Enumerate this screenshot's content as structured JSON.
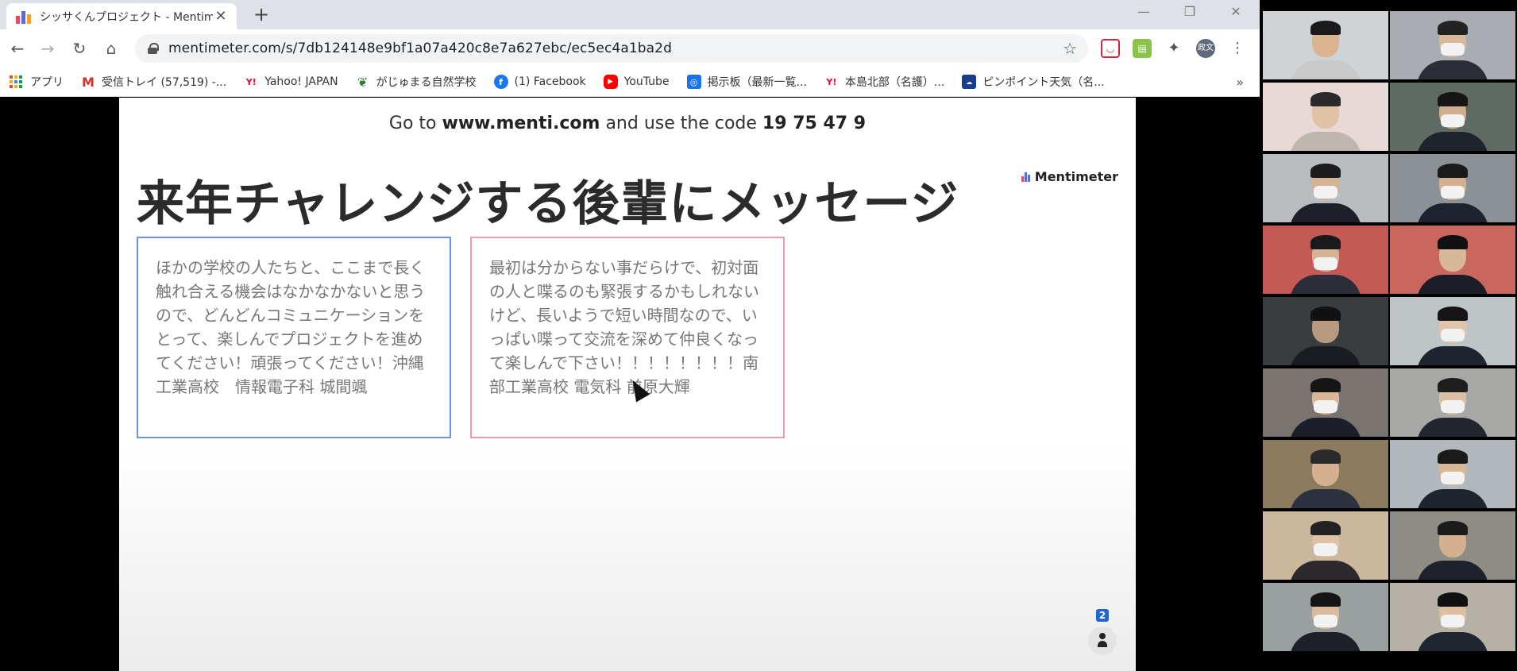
{
  "browser": {
    "tab": {
      "title": "シッサくんプロジェクト - Mentimeter"
    },
    "url": "mentimeter.com/s/7db124148e9bf1a07a420c8e7a627ebc/ec5ec4a1ba2d",
    "profile_label": "政文",
    "window_controls": {
      "minimize": "—",
      "restore": "❐",
      "close": "✕"
    },
    "bookmarks": [
      {
        "label": "アプリ",
        "icon": "apps-icon"
      },
      {
        "label": "受信トレイ (57,519) -...",
        "icon": "gmail-icon"
      },
      {
        "label": "Yahoo! JAPAN",
        "icon": "yahoo-icon"
      },
      {
        "label": "がじゅまる自然学校",
        "icon": "leaf-icon"
      },
      {
        "label": "(1) Facebook",
        "icon": "facebook-icon"
      },
      {
        "label": "YouTube",
        "icon": "youtube-icon"
      },
      {
        "label": "掲示板（最新一覧...",
        "icon": "board-icon"
      },
      {
        "label": "本島北部（名護）...",
        "icon": "yahoo-icon"
      },
      {
        "label": "ピンポイント天気（名...",
        "icon": "weather-icon"
      }
    ],
    "more_label": "»"
  },
  "slide": {
    "join_prefix": "Go to ",
    "join_url": "www.menti.com",
    "join_middle": " and use the code ",
    "join_code": "19 75 47 9",
    "logo_text": "Mentimeter",
    "title": "来年チャレンジする後輩にメッセージ",
    "cards": [
      {
        "text": "ほかの学校の人たちと、ここまで長く触れ合える機会はなかなかないと思うので、どんどんコミュニケーションをとって、楽しんでプロジェクトを進めてください！頑張ってください！沖縄工業高校　情報電子科 城間颯"
      },
      {
        "text": "最初は分からない事だらけで、初対面の人と喋るのも緊張するかもしれないけど、長いようで短い時間なので、いっぱい喋って交流を深めて仲良くなって楽しんで下さい！！！！！！！！南部工業高校 電気科 前原大輝"
      }
    ],
    "participant_count": "2"
  },
  "video_tiles": [
    {
      "bg": "#cfd3d6",
      "hair": "#1a1a1a",
      "skin": "#d9b48f",
      "mask": false,
      "body": "#c9c9c9"
    },
    {
      "bg": "#a9adb2",
      "hair": "#222222",
      "skin": "#d8b898",
      "mask": true,
      "body": "#2a2d36"
    },
    {
      "bg": "#e8d9d6",
      "hair": "#2a2a2a",
      "skin": "#e0c2a6",
      "mask": false,
      "body": "#bfb6ae"
    },
    {
      "bg": "#5f6a63",
      "hair": "#151515",
      "skin": "#cfae90",
      "mask": true,
      "body": "#1f232b"
    },
    {
      "bg": "#b9bcbe",
      "hair": "#1c1c1c",
      "skin": "#d5b395",
      "mask": true,
      "body": "#1d2029"
    },
    {
      "bg": "#8c9196",
      "hair": "#1a1a1a",
      "skin": "#d2b090",
      "mask": true,
      "body": "#1e2330"
    },
    {
      "bg": "#c45a55",
      "hair": "#1a1a1a",
      "skin": "#d6b394",
      "mask": true,
      "body": "#2b2e38"
    },
    {
      "bg": "#c9675e",
      "hair": "#111111",
      "skin": "#d9b899",
      "mask": false,
      "body": "#1b1e27"
    },
    {
      "bg": "#3a3d40",
      "hair": "#111111",
      "skin": "#b89a80",
      "mask": false,
      "body": "#1a1c22"
    },
    {
      "bg": "#bfc5c7",
      "hair": "#151515",
      "skin": "#e1c5aa",
      "mask": true,
      "body": "#202430"
    },
    {
      "bg": "#7a7470",
      "hair": "#151515",
      "skin": "#d8b897",
      "mask": true,
      "body": "#1c1f29"
    },
    {
      "bg": "#a8a8a6",
      "hair": "#1e1e1e",
      "skin": "#dcc0a5",
      "mask": true,
      "body": "#24262e"
    },
    {
      "bg": "#8c7a5e",
      "hair": "#2a2a2a",
      "skin": "#d4b08f",
      "mask": false,
      "body": "#2d3140"
    },
    {
      "bg": "#b3b8bc",
      "hair": "#1a1a1a",
      "skin": "#d6b897",
      "mask": true,
      "body": "#20242d"
    },
    {
      "bg": "#cbb79e",
      "hair": "#222222",
      "skin": "#dfc2a3",
      "mask": true,
      "body": "#2c2a2c"
    },
    {
      "bg": "#8e8c85",
      "hair": "#1b1b1b",
      "skin": "#d3b190",
      "mask": false,
      "body": "#1f222b"
    },
    {
      "bg": "#9aa09f",
      "hair": "#151515",
      "skin": "#d9bb9c",
      "mask": true,
      "body": "#1e2028"
    },
    {
      "bg": "#b6b1a6",
      "hair": "#111111",
      "skin": "#dcbf9f",
      "mask": true,
      "body": "#21252f"
    }
  ]
}
